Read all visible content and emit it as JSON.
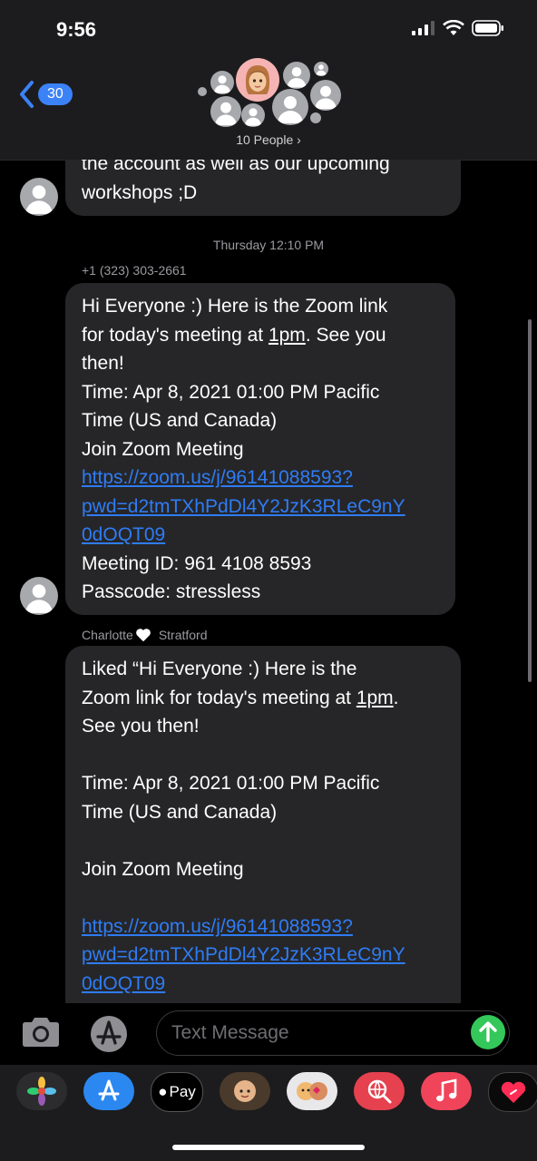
{
  "status": {
    "time": "9:56"
  },
  "header": {
    "back_count": "30",
    "people_label": "10 People ›"
  },
  "messages": {
    "prev_lines": [
      "the account as well as our upcoming",
      "workshops ;D"
    ],
    "timestamp": "Thursday 12:10 PM",
    "sender1": "+1 (323) 303-2661",
    "msg1": {
      "l1": "Hi Everyone :) Here is the Zoom link",
      "l2a": "for today's meeting at ",
      "l2b": "1pm",
      "l2c": ". See you",
      "l3": "then!",
      "l4": "Time: Apr 8, 2021 01:00 PM Pacific",
      "l5": "Time (US and Canada)",
      "l6": "Join Zoom Meeting",
      "link1": "https://zoom.us/j/96141088593?",
      "link2": "pwd=d2tmTXhPdDl4Y2JzK3RLeC9nY",
      "link3": "0dOQT09",
      "l7": "Meeting ID: 961 4108 8593",
      "l8": "Passcode: stressless"
    },
    "sender2_first": "Charlotte",
    "sender2_last": "Stratford",
    "msg2": {
      "l1": "Liked “Hi Everyone :) Here is the",
      "l2a": "Zoom link for today's meeting at ",
      "l2b": "1pm",
      "l2c": ".",
      "l3": "See you then!",
      "l4": "Time: Apr 8, 2021 01:00 PM Pacific",
      "l5": "Time (US and Canada)",
      "l6": "Join Zoom Meeting",
      "link1": "https://zoom.us/j/96141088593?",
      "link2": "pwd=d2tmTXhPdDl4Y2JzK3RLeC9nY",
      "link3": "0dOQT09"
    }
  },
  "composer": {
    "placeholder": "Text Message"
  },
  "apps": {
    "apple_pay_label": "Pay"
  },
  "colors": {
    "accent": "#2f7cf6",
    "send": "#34c759",
    "bubble": "#262628",
    "badge": "#3b82f6"
  }
}
